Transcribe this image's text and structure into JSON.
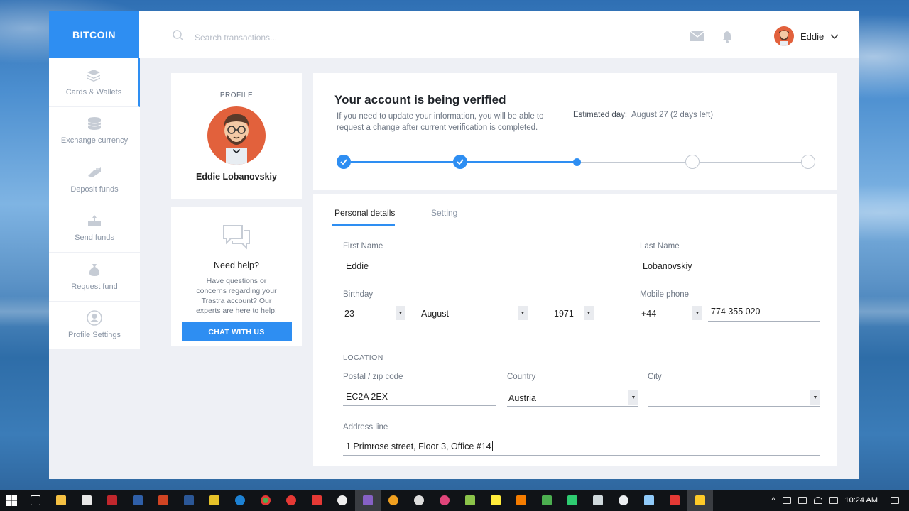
{
  "brand": "BITCOIN",
  "sidebar": {
    "items": [
      {
        "label": "Cards & Wallets",
        "icon": "layers-icon",
        "active": true
      },
      {
        "label": "Exchange currency",
        "icon": "coins-icon"
      },
      {
        "label": "Deposit funds",
        "icon": "deposit-icon"
      },
      {
        "label": "Send funds",
        "icon": "send-icon"
      },
      {
        "label": "Request fund",
        "icon": "money-bag-icon"
      },
      {
        "label": "Profile  Settings",
        "icon": "user-icon"
      }
    ]
  },
  "header": {
    "search_placeholder": "Search transactions...",
    "user_name": "Eddie"
  },
  "profile": {
    "label": "PROFILE",
    "name": "Eddie Lobanovskiy"
  },
  "help": {
    "title": "Need help?",
    "text": "Have questions or concerns regarding your Trastra account? Our experts are here to help!",
    "button": "CHAT WITH US"
  },
  "verification": {
    "title": "Your account is being verified",
    "description": "If you need to update your information, you will be able to request a change after current verification is completed.",
    "estimated_label": "Estimated day:",
    "estimated_value": "August 27 (2 days left)",
    "steps": [
      "done",
      "done",
      "current",
      "todo",
      "todo"
    ]
  },
  "tabs": [
    "Personal details",
    "Setting"
  ],
  "personal": {
    "first_name_label": "First Name",
    "first_name": "Eddie",
    "last_name_label": "Last Name",
    "last_name": "Lobanovskiy",
    "birthday_label": "Birthday",
    "birth_day": "23",
    "birth_month": "August",
    "birth_year": "1971",
    "mobile_label": "Mobile phone",
    "phone_code": "+44",
    "phone_number": "774 355 020"
  },
  "location": {
    "title": "LOCATION",
    "postal_label": "Postal / zip code",
    "postal": "EC2A 2EX",
    "country_label": "Country",
    "country": "Austria",
    "city_label": "City",
    "city": "",
    "address_label": "Address line",
    "address": "1 Primrose street, Floor 3, Office #14"
  },
  "taskbar": {
    "time": "10:24 AM"
  },
  "colors": {
    "accent": "#2e8ef2",
    "avatar": "#e2613c"
  }
}
